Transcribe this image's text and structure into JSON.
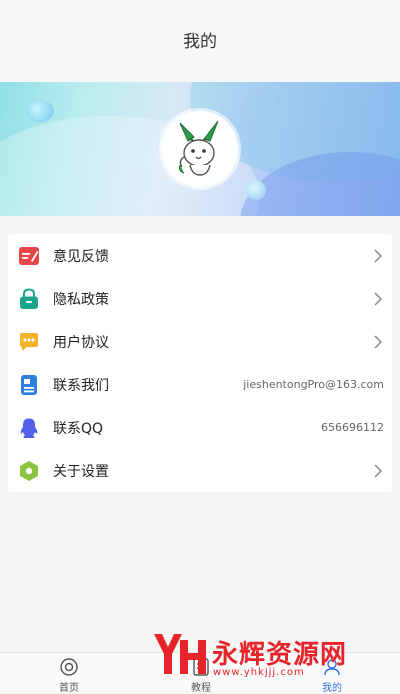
{
  "header": {
    "title": "我的"
  },
  "profile": {
    "avatar_icon": "cartoon-rabbit-avatar"
  },
  "menu": {
    "items": [
      {
        "label": "意见反馈",
        "icon": "feedback-icon",
        "value": "",
        "has_arrow": true
      },
      {
        "label": "隐私政策",
        "icon": "privacy-lock-icon",
        "value": "",
        "has_arrow": true
      },
      {
        "label": "用户协议",
        "icon": "chat-bubble-icon",
        "value": "",
        "has_arrow": true
      },
      {
        "label": "联系我们",
        "icon": "contact-card-icon",
        "value": "jieshentongPro@163.com",
        "has_arrow": false
      },
      {
        "label": "联系QQ",
        "icon": "qq-penguin-icon",
        "value": "656696112",
        "has_arrow": false
      },
      {
        "label": "关于设置",
        "icon": "settings-hexagon-icon",
        "value": "",
        "has_arrow": true
      }
    ]
  },
  "tabbar": {
    "tabs": [
      {
        "label": "首页",
        "icon": "home-icon",
        "active": false
      },
      {
        "label": "教程",
        "icon": "tutorial-icon",
        "active": false
      },
      {
        "label": "我的",
        "icon": "profile-icon",
        "active": true
      }
    ]
  },
  "watermark": {
    "brand": "永辉资源网",
    "url": "www.yhkjjj.com",
    "logo": "YH"
  },
  "colors": {
    "accent": "#3a6fd8",
    "feedback": "#e8474a",
    "privacy": "#1aa58a",
    "agreement": "#f3b32c",
    "contact": "#2f7fe0",
    "qq": "#5360e8",
    "settings": "#8bc53f",
    "watermark": "#e8242b"
  }
}
